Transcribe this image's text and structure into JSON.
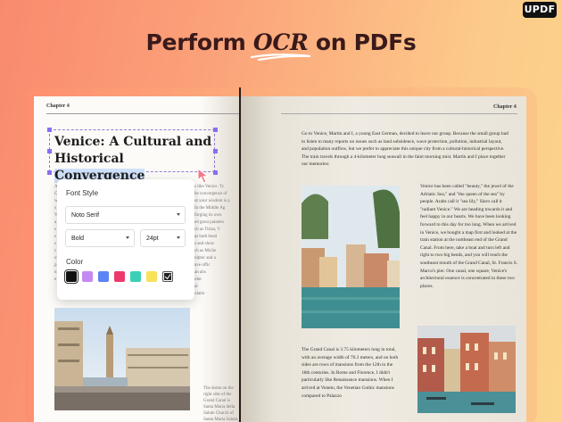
{
  "logo": "UPDF",
  "headline": {
    "pre": "Perform ",
    "ocr": "OCR",
    "post": " on PDFs"
  },
  "left_page": {
    "chapter": "Chapter 4",
    "title_line1": "Venice: A Cultural and",
    "title_line2_plain": "Historical ",
    "title_line2_highlight": "Convergence",
    "bg_lines": [
      "s like Venice. Ty",
      "he convergence of",
      "ut your wisdom is p",
      "In the Middle Ag",
      "forging its own",
      "ed great painters",
      "ch as Titian, V",
      "as both bustl",
      "s and show",
      "ch as Miche",
      "ulptor and a",
      "ave offic",
      "an abs",
      "olut",
      "al",
      "ulatio"
    ],
    "caption": "The dome on the right side of the Grand Canal is Santa Maria della Salute Church of Santa Maria Salute, was built in 1631 to commemorate the end of plague"
  },
  "panel": {
    "font_style_label": "Font Style",
    "font_name": "Noto Serif",
    "weight": "Bold",
    "size": "24pt",
    "color_label": "Color",
    "colors": [
      "#111111",
      "#c58af2",
      "#5b84f5",
      "#ec3a6e",
      "#3ad0b8",
      "#f7e25a"
    ]
  },
  "right_page": {
    "chapter": "Chapter 4",
    "intro": "Go to Venice, Martin and I, a young East German, decided to leave our group. Because the small group had to listen to many reports on issues such as land subsidence, wave protection, pollution, industrial layout, and population outflow, but we prefer to appreciate this unique city from a cultural-historical perspective. The train travels through a 4-kilometer long seawall in the faint morning mist. Martin and I place together our memories:",
    "col_right": "Venice has been called \"beauty,\" the jewel of the Adriatic Sea,\" and \"the queen of the sea\" by people. Arabs call it \"sea lily,\" Slavs call it \"radiant Venice.\" We are heading towards it and feel happy in our hearts. We have been looking forward to this day for too long. When we arrived in Venice, we bought a map first and looked at the train station at the northeast end of the Grand Canal. From here, take a boat and turn left and right to two big bends, and you will reach the southeast mouth of the Grand Canal, St. Francis S. Marco's pier. One canal, one square, Venice's architectural essence is concentrated in these two places.",
    "col_left": "The Grand Canal is 3.75 kilometers long in total, with an average width of 70.3 meters, and on both sides are rows of mansions from the 12th to the 18th centuries. In Rome and Florence, I didn't particularly like Renaissance mansions. When I arrived at Veneto, the Venetian Gothic mansions compared to Palazzo"
  }
}
